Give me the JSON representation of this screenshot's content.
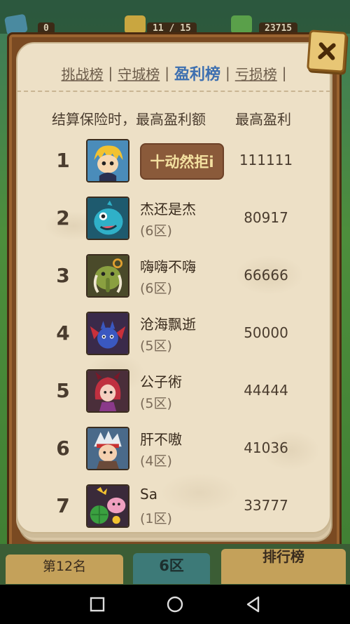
{
  "hud": {
    "values": [
      "0",
      "11 / 15",
      "23715"
    ]
  },
  "tabs": [
    {
      "label": "挑战榜",
      "active": false
    },
    {
      "label": "守城榜",
      "active": false
    },
    {
      "label": "盈利榜",
      "active": true
    },
    {
      "label": "亏损榜",
      "active": false
    }
  ],
  "tab_separator": "|",
  "header": {
    "left": "结算保险时，最高盈利额",
    "right": "最高盈利"
  },
  "rows": [
    {
      "rank": "1",
      "name": "十动然拒i",
      "zone": "",
      "score": "111111",
      "highlight": true,
      "avatar": "blond-hero-icon"
    },
    {
      "rank": "2",
      "name": "杰还是杰",
      "zone": "(6区)",
      "score": "80917",
      "highlight": false,
      "avatar": "blue-dino-icon"
    },
    {
      "rank": "3",
      "name": "嗨嗨不嗨",
      "zone": "(6区)",
      "score": "66666",
      "highlight": false,
      "avatar": "green-mammoth-icon"
    },
    {
      "rank": "4",
      "name": "沧海飘逝",
      "zone": "(5区)",
      "score": "50000",
      "highlight": false,
      "avatar": "blue-demon-icon"
    },
    {
      "rank": "5",
      "name": "公子術",
      "zone": "(5区)",
      "score": "44444",
      "highlight": false,
      "avatar": "red-devil-girl-icon"
    },
    {
      "rank": "6",
      "name": "肝不嗷",
      "zone": "(4区)",
      "score": "41036",
      "highlight": false,
      "avatar": "white-hair-fighter-icon"
    },
    {
      "rank": "7",
      "name": "Sa",
      "zone": "(1区)",
      "score": "33777",
      "highlight": false,
      "avatar": "fruit-bunch-icon"
    }
  ],
  "bottom_bar": {
    "my_rank": "第12名",
    "my_zone": "6区",
    "leaderboard_button": "排行榜"
  },
  "colors": {
    "paper": "#ede0c6",
    "active_tab": "#3d6fb0",
    "frame": "#7a4a22",
    "highlight_button": "#8a5a3a"
  }
}
